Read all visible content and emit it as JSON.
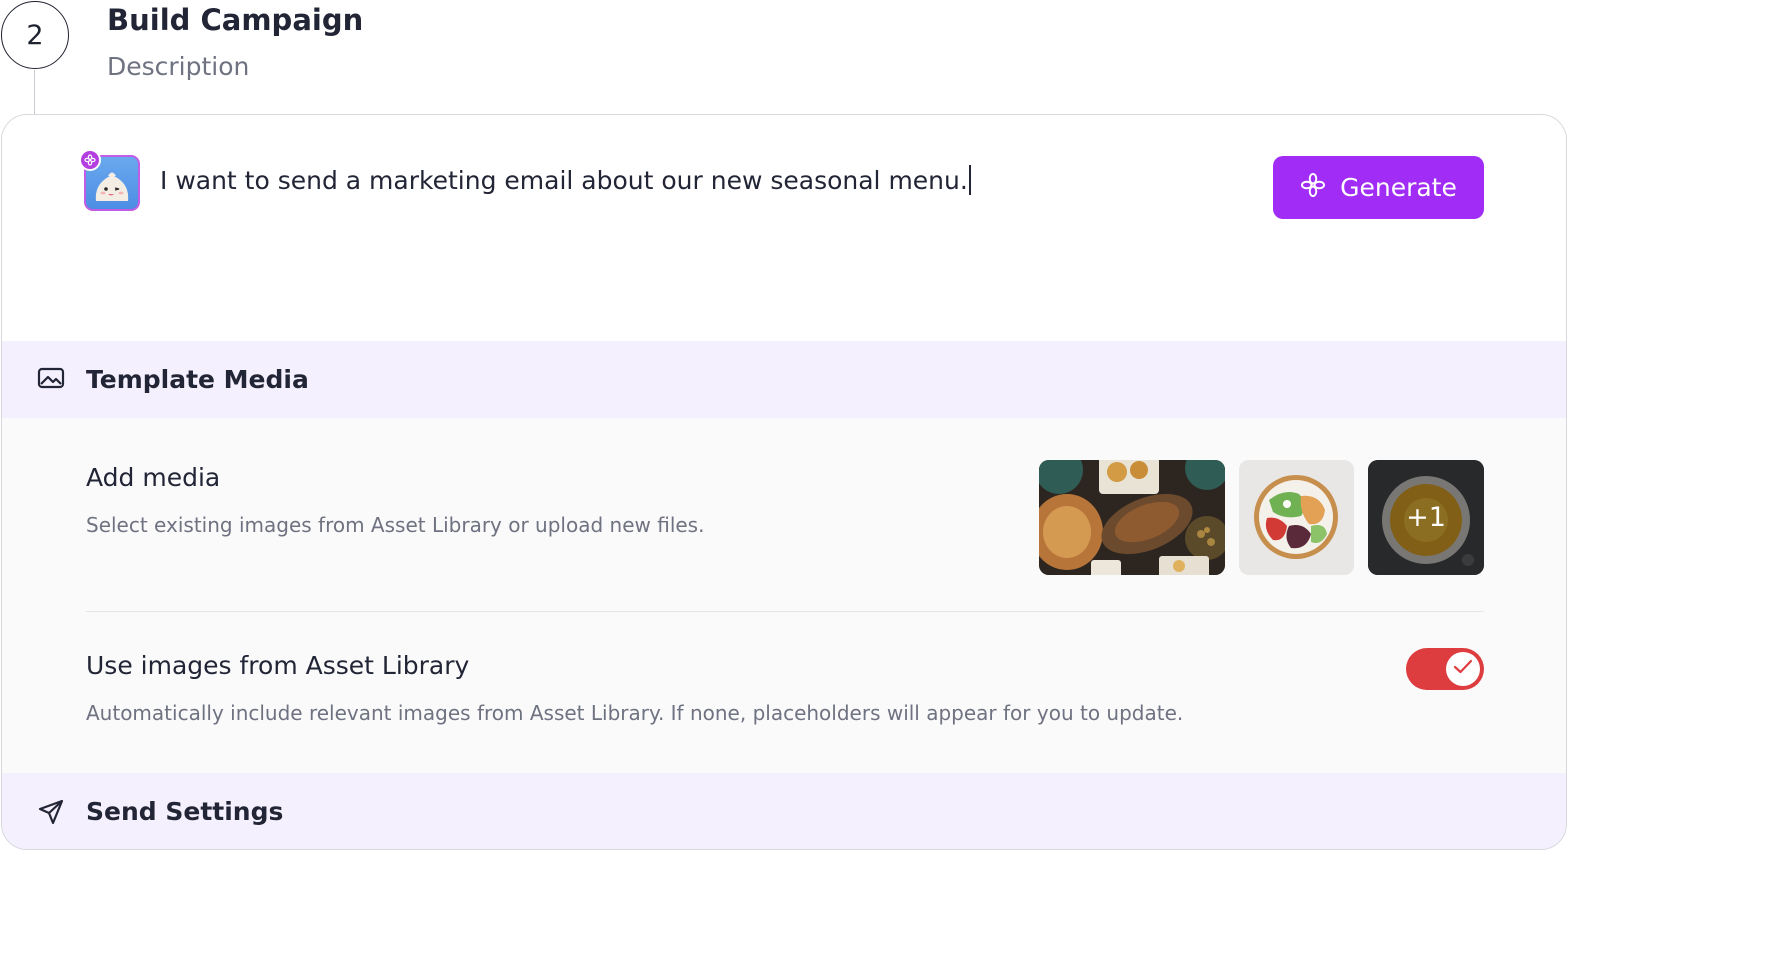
{
  "step": {
    "number": "2",
    "title": "Build Campaign",
    "description": "Description"
  },
  "prompt": {
    "text": "I want to send a marketing email about our new seasonal menu.",
    "generate_label": "Generate"
  },
  "template_media": {
    "title": "Template Media",
    "add_media": {
      "title": "Add media",
      "subtitle": "Select existing images from Asset Library or upload new files.",
      "more_count": "+1"
    },
    "use_asset_library": {
      "title": "Use images from Asset Library",
      "subtitle": "Automatically include relevant images from Asset Library. If none, placeholders will appear for you to update.",
      "enabled": true
    }
  },
  "send_settings": {
    "title": "Send Settings"
  },
  "colors": {
    "accent": "#a12cf5",
    "toggle_on": "#de3d3f",
    "section_bg": "#f5f0fd"
  },
  "icons": {
    "generate": "sparkle-flower-icon",
    "template_media": "image-icon",
    "send_settings": "send-icon"
  }
}
